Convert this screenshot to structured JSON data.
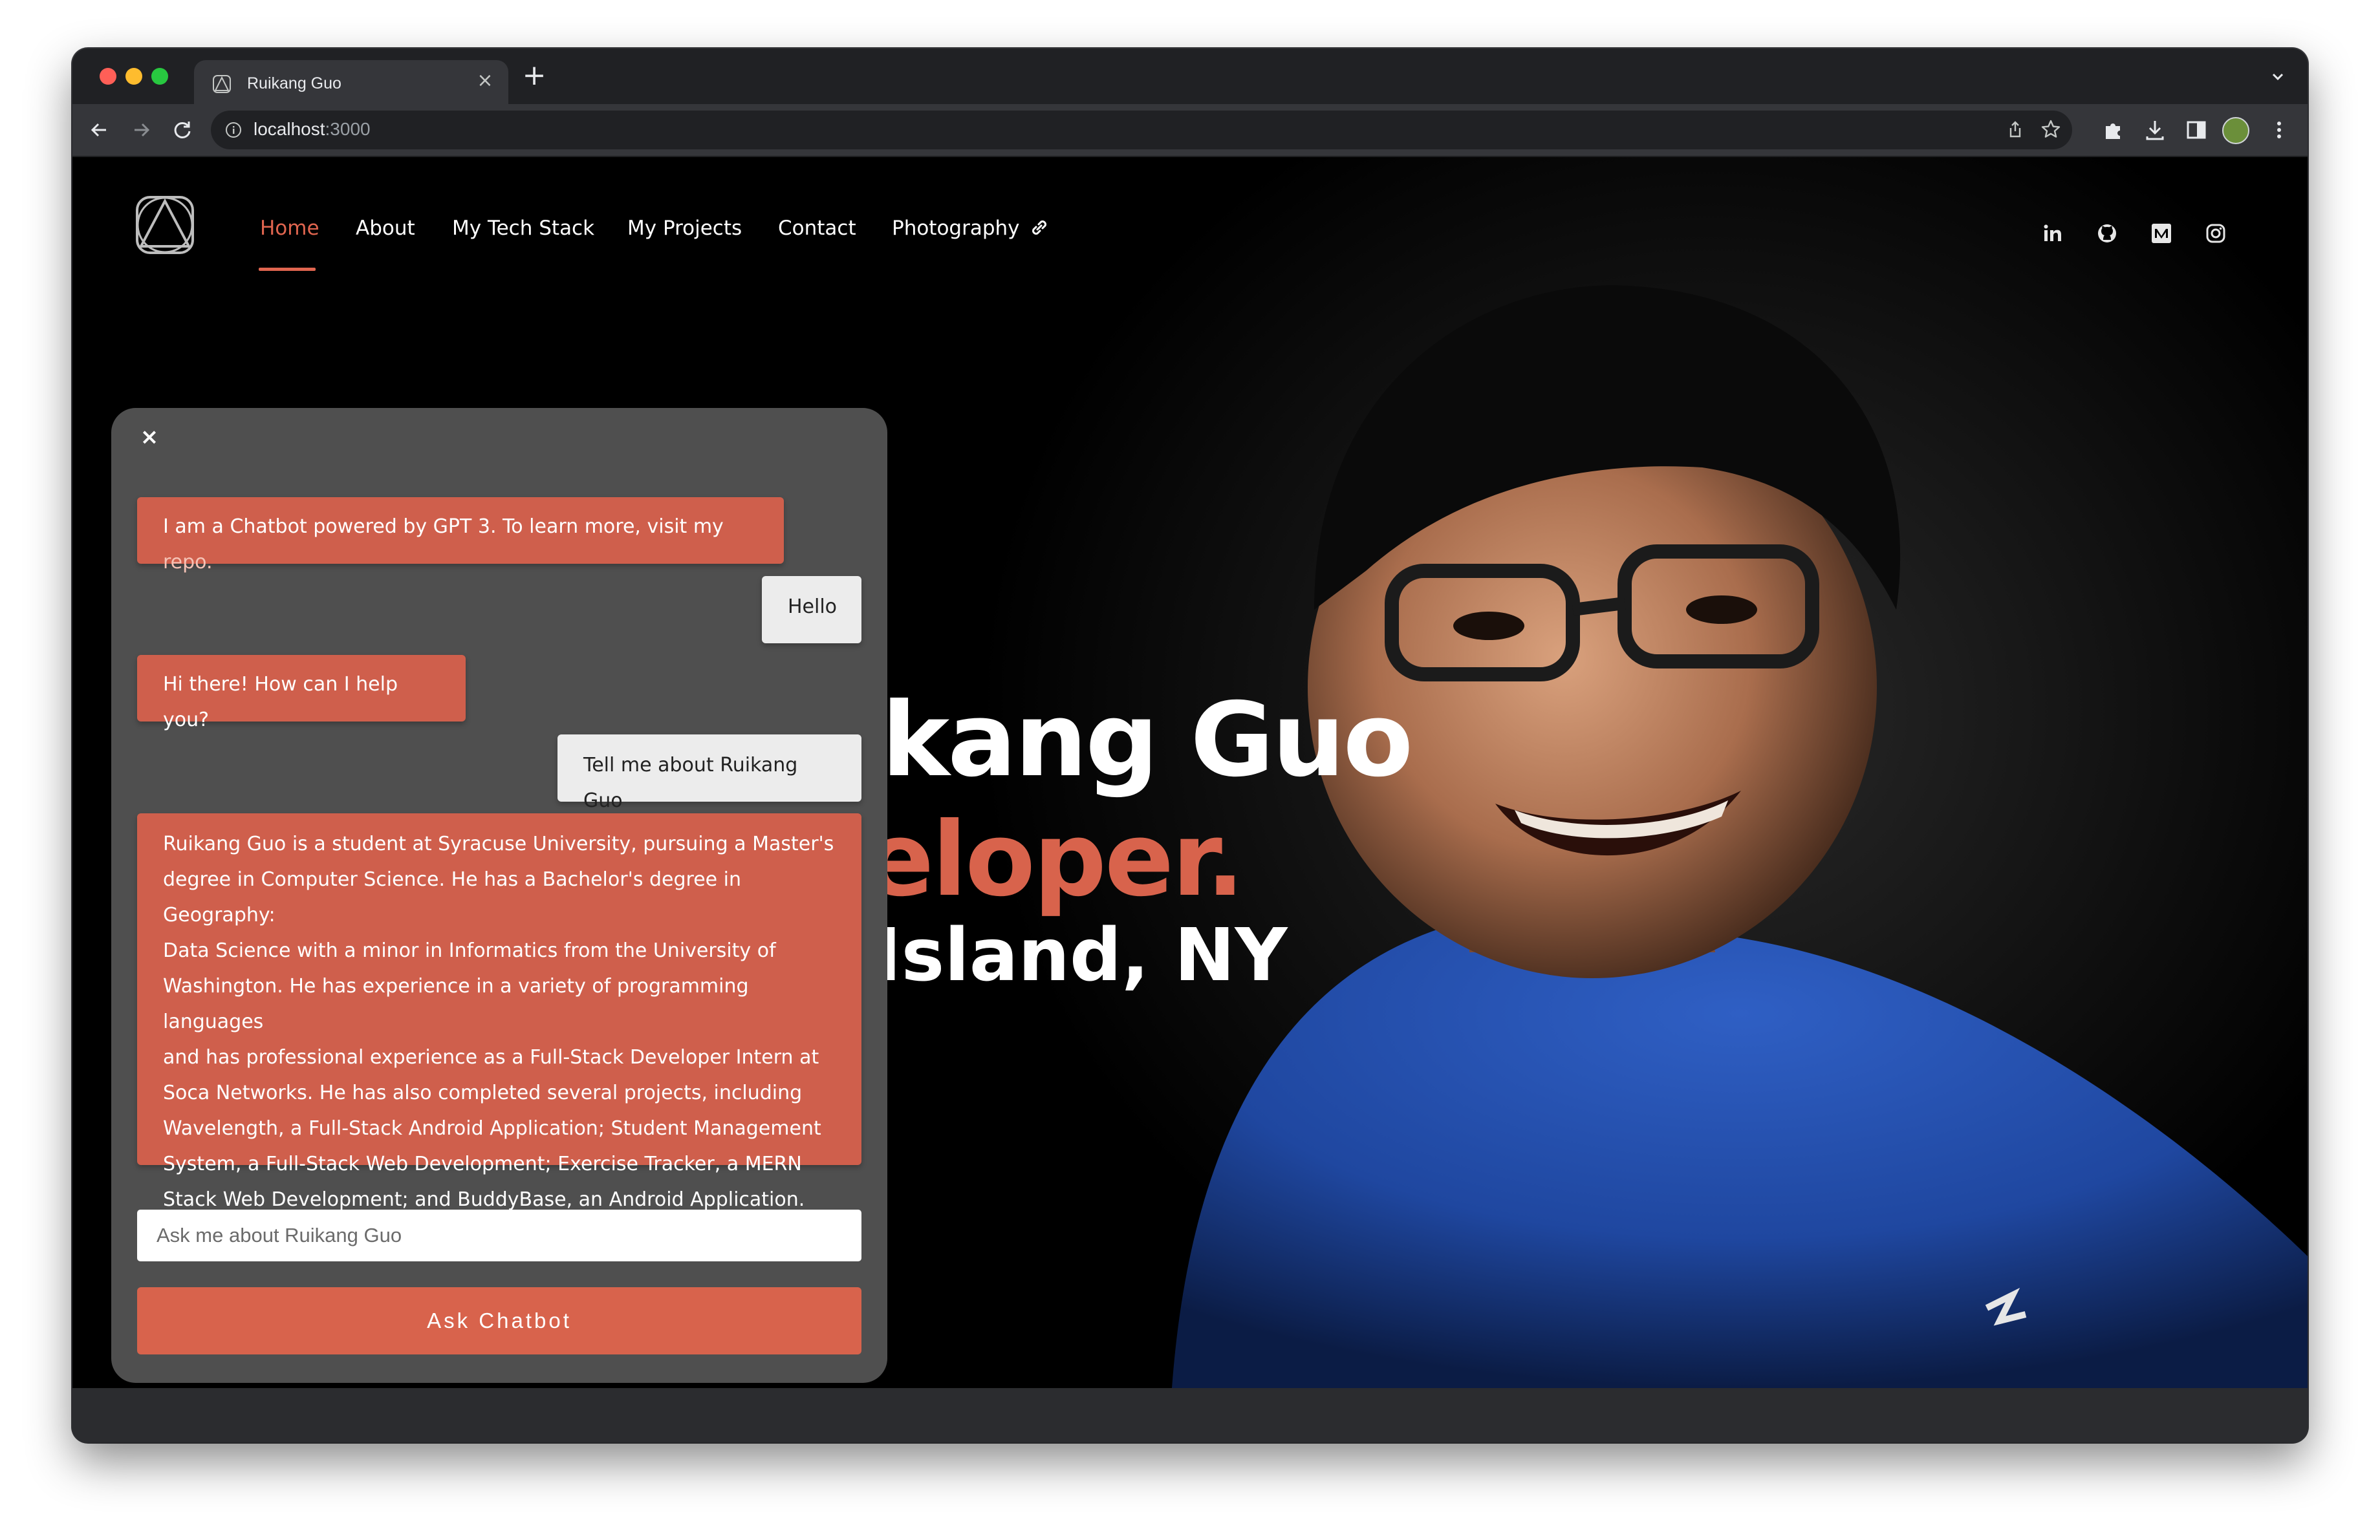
{
  "browser": {
    "tab_title": "Ruikang Guo",
    "new_tab": "+",
    "url_host": "localhost",
    "url_port": ":3000"
  },
  "nav": {
    "items": [
      {
        "label": "Home",
        "active": true
      },
      {
        "label": "About"
      },
      {
        "label": "My Tech Stack"
      },
      {
        "label": "My Projects"
      },
      {
        "label": "Contact"
      },
      {
        "label": "Photography"
      }
    ]
  },
  "social": [
    "linkedin-icon",
    "github-icon",
    "medium-icon",
    "instagram-icon"
  ],
  "hero": {
    "name": "ikang Guo",
    "role": "eloper.",
    "location": "Island, NY"
  },
  "chat": {
    "close": "×",
    "intro_text": "I am a Chatbot powered by GPT 3. To learn more, visit my ",
    "intro_link": "repo",
    "intro_end": ".",
    "user_1": "Hello",
    "bot_1": "Hi there! How can I help you?",
    "user_2": "Tell me about Ruikang Guo",
    "bot_2_lines": [
      "Ruikang Guo is a student at Syracuse University, pursuing a Master's",
      "degree in Computer Science. He has a Bachelor's degree in Geography:",
      "Data Science with a minor in Informatics from the University of",
      "Washington. He has experience in a variety of programming languages",
      "and has professional experience as a Full-Stack Developer Intern at",
      "Soca Networks. He has also completed several projects, including",
      "Wavelength, a Full-Stack Android Application; Student Management",
      "System, a Full-Stack Web Development; Exercise Tracker, a MERN",
      "Stack Web Development; and BuddyBase, an Android Application."
    ],
    "input_placeholder": "Ask me about Ruikang Guo",
    "button_label": "Ask Chatbot"
  },
  "colors": {
    "accent": "#d8634c",
    "bot_bubble": "#cf5f4c",
    "user_bubble": "#ececec",
    "chat_panel": "#4f4f4f",
    "page_bg": "#000000"
  }
}
